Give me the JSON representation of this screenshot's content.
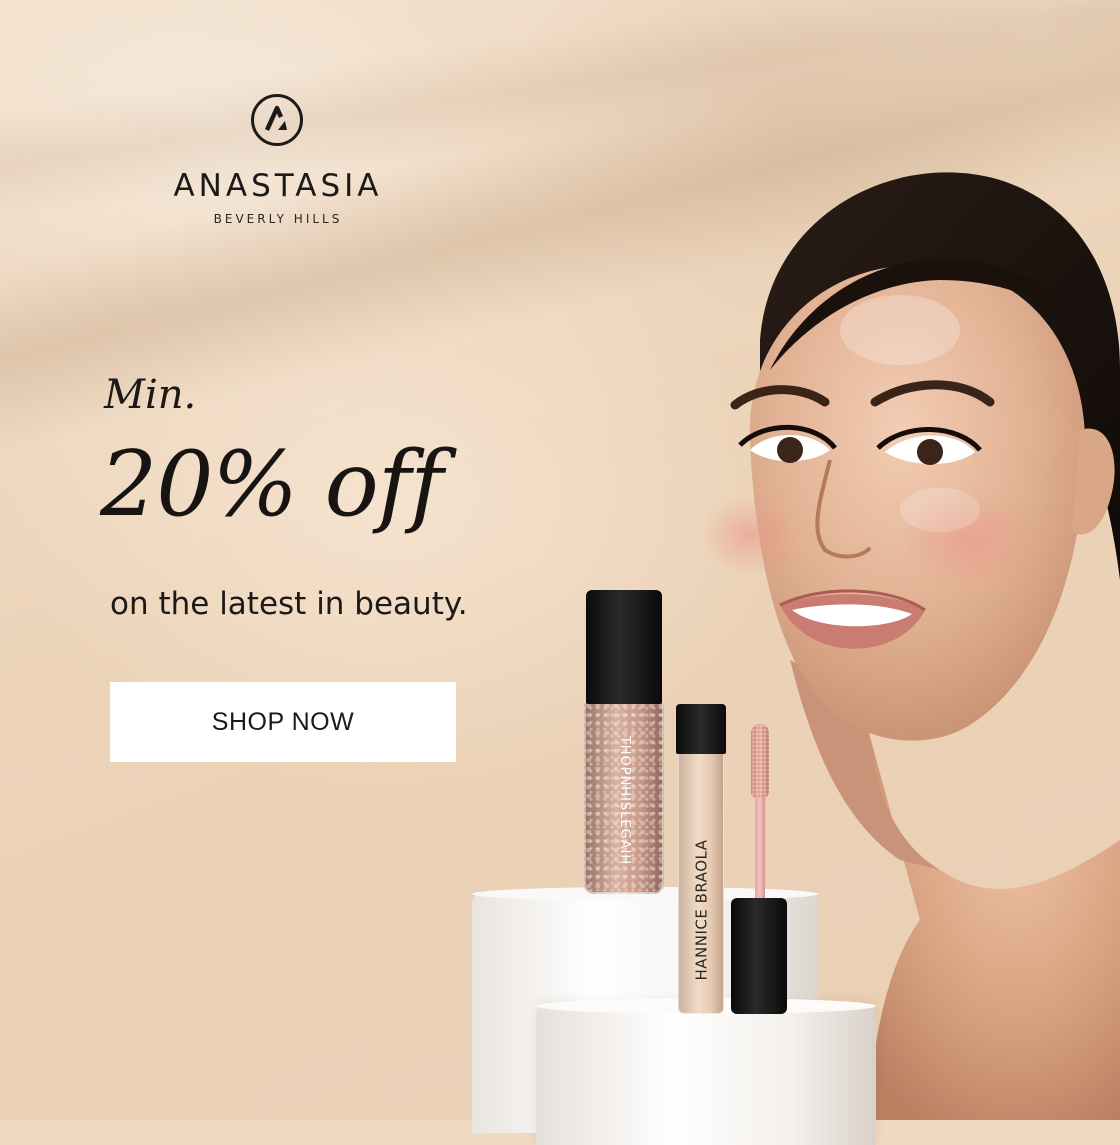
{
  "brand": {
    "name": "ANASTASIA",
    "subtitle": "BEVERLY HILLS",
    "logo_icon": "ah-monogram-circle-icon"
  },
  "promo": {
    "prefix": "Min.",
    "headline": "20% off",
    "subline": "on the latest in beauty."
  },
  "cta": {
    "label": "SHOP NOW"
  },
  "products": {
    "bottle_label": "THOPNHISLEGAIH",
    "tube_label": "HANNICE BRAOLA"
  },
  "colors": {
    "background": "#efd9c0",
    "text": "#1c1a18",
    "button_bg": "#ffffff"
  }
}
